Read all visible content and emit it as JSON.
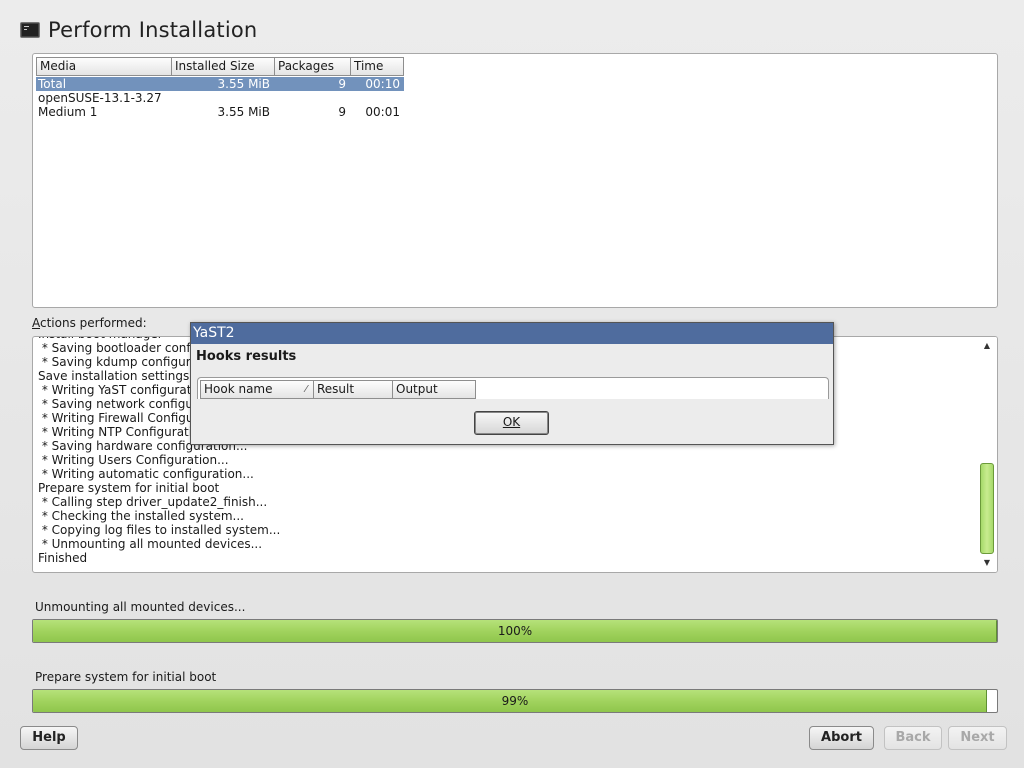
{
  "header": {
    "title": "Perform Installation",
    "icon": "terminal-icon"
  },
  "media_table": {
    "columns": [
      "Media",
      "Installed Size",
      "Packages",
      "Time"
    ],
    "rows": [
      {
        "media": "Total",
        "size": "3.55 MiB",
        "packages": "9",
        "time": "00:10",
        "selected": true
      },
      {
        "media": "openSUSE-13.1-3.27",
        "size": "",
        "packages": "",
        "time": "",
        "selected": false
      },
      {
        "media": "Medium 1",
        "size": "3.55 MiB",
        "packages": "9",
        "time": "00:01",
        "selected": false
      }
    ]
  },
  "actions": {
    "label_first": "A",
    "label_rest": "ctions performed:",
    "lines": [
      "Install boot manager",
      " * Saving bootloader configuration...",
      " * Saving kdump configuration...",
      "Save installation settings",
      " * Writing YaST configuration...",
      " * Saving network configuration...",
      " * Writing Firewall Configuration...",
      " * Writing NTP Configuration...",
      " * Saving hardware configuration...",
      " * Writing Users Configuration...",
      " * Writing automatic configuration...",
      "Prepare system for initial boot",
      " * Calling step driver_update2_finish...",
      " * Checking the installed system...",
      " * Copying log files to installed system...",
      " * Unmounting all mounted devices...",
      "Finished"
    ]
  },
  "progress": {
    "step_label": "Unmounting all mounted devices...",
    "step_percent_text": "100%",
    "step_value": 100,
    "stage_label": "Prepare system for initial boot",
    "stage_percent_text": "99%",
    "stage_value": 99
  },
  "buttons": {
    "help": "Help",
    "abort": "Abort",
    "back": "Back",
    "next": "Next"
  },
  "dialog": {
    "title": "YaST2",
    "heading": "Hooks results",
    "columns": [
      "Hook name",
      "Result",
      "Output"
    ],
    "ok_label": "OK"
  },
  "colors": {
    "selection": "#7292bc",
    "dialog_title": "#4f6c9e",
    "progress_fill": "#a1d35e"
  }
}
